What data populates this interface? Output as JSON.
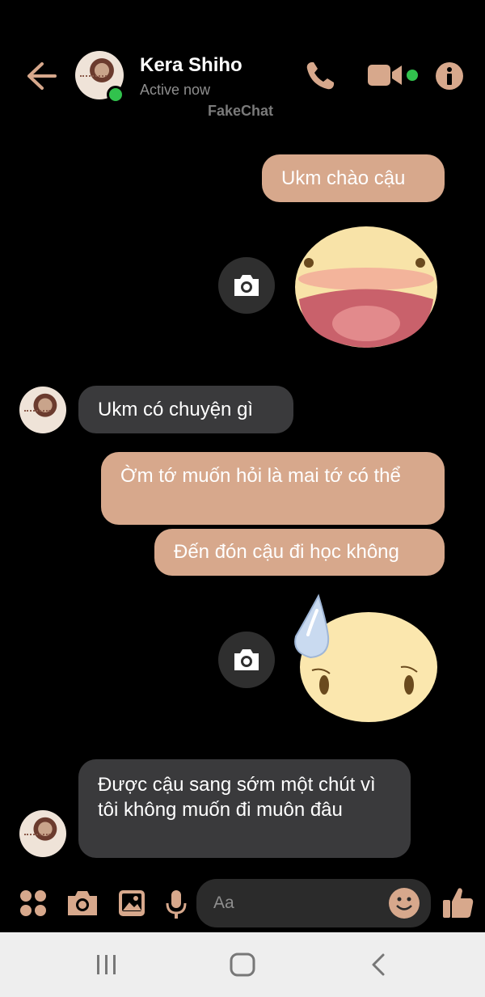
{
  "header": {
    "contact_name": "Kera Shiho",
    "status": "Active now",
    "watermark": "FakeChat",
    "icons": [
      "back-arrow-icon",
      "phone-icon",
      "video-camera-icon",
      "info-icon"
    ],
    "accent_color": "#d7a88c",
    "online_color": "#31c24d"
  },
  "messages": [
    {
      "sender": "me",
      "type": "text",
      "text": "Ukm chào cậu"
    },
    {
      "sender": "me",
      "type": "sticker",
      "sticker": "laughing-face"
    },
    {
      "sender": "them",
      "type": "text",
      "text": "Ukm có chuyện gì"
    },
    {
      "sender": "me",
      "type": "text",
      "text": "Ờm tớ muốn hỏi là mai tớ có thể"
    },
    {
      "sender": "me",
      "type": "text",
      "text": "Đến đón cậu đi học không"
    },
    {
      "sender": "me",
      "type": "sticker",
      "sticker": "sweat-face"
    },
    {
      "sender": "them",
      "type": "text",
      "text": "Được cậu sang sớm một chút vì tôi không muốn đi muôn đâu"
    }
  ],
  "composer": {
    "placeholder": "Aa",
    "icons": [
      "apps-grid-icon",
      "camera-icon",
      "gallery-icon",
      "microphone-icon",
      "emoji-icon",
      "thumbs-up-icon"
    ]
  },
  "system_nav": {
    "icons": [
      "recent-apps-icon",
      "home-icon",
      "back-icon"
    ]
  }
}
